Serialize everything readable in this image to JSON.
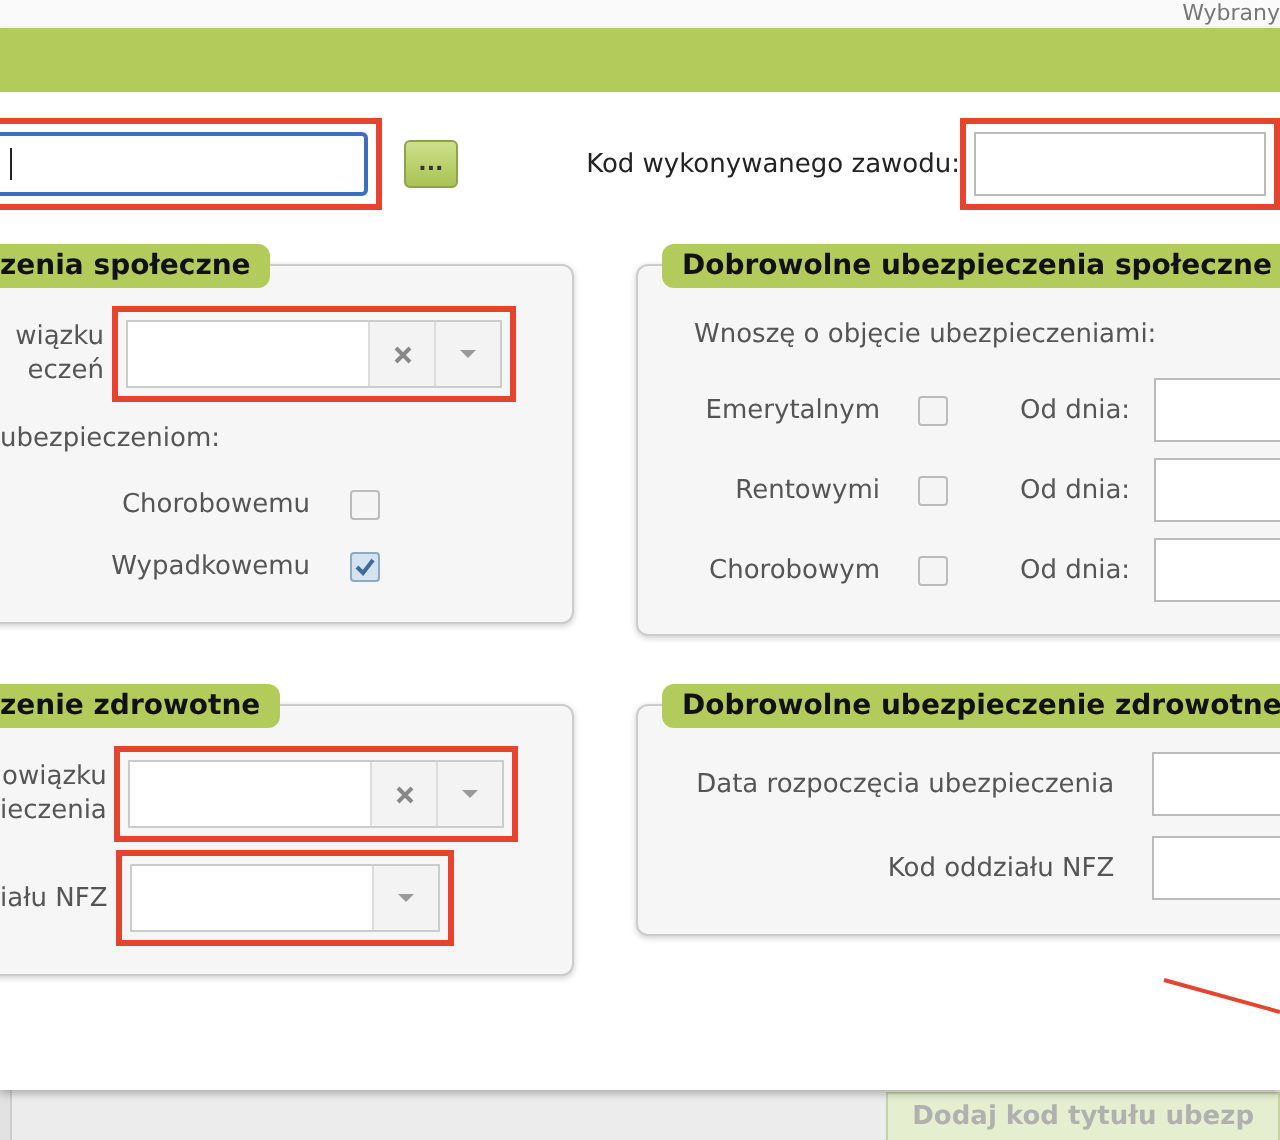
{
  "background": {
    "text": "Wybrany"
  },
  "top_row": {
    "field": {
      "focused": true,
      "highlighted": true
    },
    "browse_button": {
      "label": "..."
    },
    "occupation_code": {
      "label": "Kod wykonywanego zawodu:",
      "highlighted": true
    }
  },
  "panels": [
    {
      "title": "zenia społeczne",
      "rows": [
        {
          "kind": "combo",
          "label": "wiązku\neczeń",
          "clearable": true,
          "highlighted": true
        },
        {
          "kind": "note",
          "text": "ubezpieczeniom:"
        },
        {
          "kind": "checkbox",
          "label": "Chorobowemu",
          "checked": false
        },
        {
          "kind": "checkbox",
          "label": "Wypadkowemu",
          "checked": true
        }
      ]
    },
    {
      "title": "Dobrowolne ubezpieczenia społeczne",
      "rows": [
        {
          "kind": "note",
          "text": "Wnoszę o objęcie ubezpieczeniami:"
        },
        {
          "kind": "checkbox_date",
          "label": "Emerytalnym",
          "checked": false,
          "date_label": "Od dnia:"
        },
        {
          "kind": "checkbox_date",
          "label": "Rentowymi",
          "checked": false,
          "date_label": "Od dnia:"
        },
        {
          "kind": "checkbox_date",
          "label": "Chorobowym",
          "checked": false,
          "date_label": "Od dnia:"
        }
      ]
    },
    {
      "title": "zenie zdrowotne",
      "rows": [
        {
          "kind": "combo",
          "label": "owiązku\nieczenia",
          "clearable": true,
          "highlighted": true
        },
        {
          "kind": "combo",
          "label": "iału NFZ",
          "clearable": false,
          "highlighted": true
        }
      ]
    },
    {
      "title": "Dobrowolne ubezpieczenie zdrowotne",
      "rows": [
        {
          "kind": "field",
          "label": "Data rozpoczęcia ubezpieczenia"
        },
        {
          "kind": "field",
          "label": "Kod oddziału NFZ"
        }
      ]
    }
  ],
  "annotations": [
    {
      "kind": "line"
    }
  ],
  "footer": {
    "button": {
      "label": "Dodaj kod tytułu ubezp",
      "disabled": true
    }
  }
}
